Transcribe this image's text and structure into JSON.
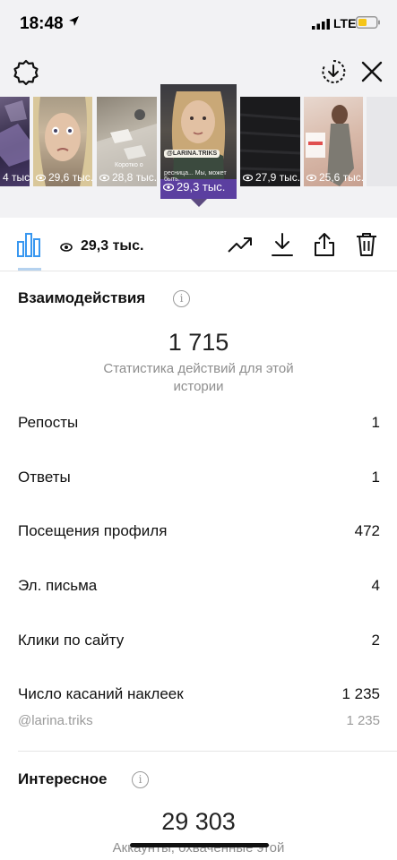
{
  "status_bar": {
    "time": "18:48",
    "network": "LTE"
  },
  "stories": [
    {
      "views": "4 тыс."
    },
    {
      "views": "29,6 тыс."
    },
    {
      "views": "28,8 тыс.",
      "caption": "Коротко о"
    },
    {
      "views": "29,3 тыс.",
      "tag": "@LARINA.TRIKS",
      "caption": "ресница... Мы, может быть.",
      "selected": true
    },
    {
      "views": "27,9 тыс."
    },
    {
      "views": "25,6 тыс."
    }
  ],
  "toolbar": {
    "views": "29,3 тыс.",
    "icons": [
      "bar-chart-icon",
      "eye-icon",
      "trending-icon",
      "download-icon",
      "share-icon",
      "trash-icon"
    ]
  },
  "interactions": {
    "title": "Взаимодействия",
    "total": "1 715",
    "caption": "Статистика действий для этой истории",
    "rows": [
      {
        "label": "Репосты",
        "value": "1"
      },
      {
        "label": "Ответы",
        "value": "1"
      },
      {
        "label": "Посещения профиля",
        "value": "472"
      },
      {
        "label": "Эл. письма",
        "value": "4"
      },
      {
        "label": "Клики по сайту",
        "value": "2"
      },
      {
        "label": "Число касаний наклеек",
        "value": "1 235"
      }
    ],
    "sticker": {
      "label": "@larina.triks",
      "value": "1 235"
    }
  },
  "discovery": {
    "title": "Интересное",
    "total": "29 303",
    "caption": "Аккаунты, охваченные этой"
  },
  "colors": {
    "accent": "#3897f0",
    "caret": "#5c4a80"
  }
}
